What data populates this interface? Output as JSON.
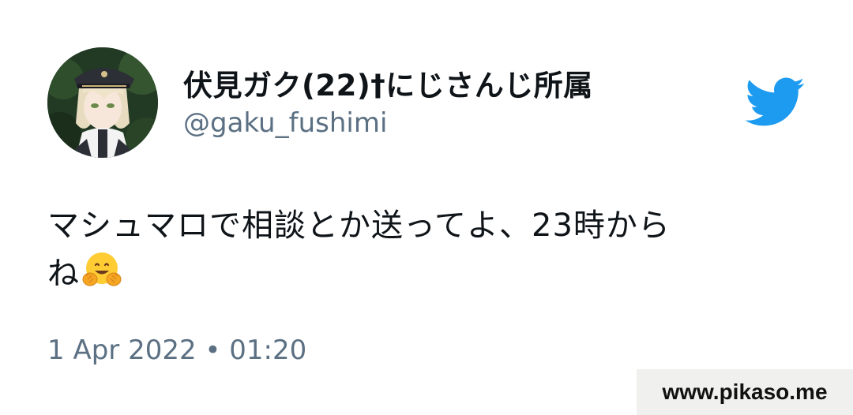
{
  "tweet": {
    "display_name": "伏見ガク(22)†にじさんじ所属",
    "username": "@gaku_fushimi",
    "text_line1": "マシュマロで相談とか送ってよ、23時から",
    "text_line2": "ね",
    "emoji_name": "hugging-face-emoji",
    "timestamp": "1 Apr 2022 • 01:20"
  },
  "brand": {
    "logo": "twitter-bird-icon",
    "accent_color": "#1d9bf0"
  },
  "watermark": {
    "text": "www.pikaso.me"
  },
  "colors": {
    "text_primary": "#0f1419",
    "text_secondary": "#5b7083",
    "watermark_bg": "#f0f0ee"
  }
}
